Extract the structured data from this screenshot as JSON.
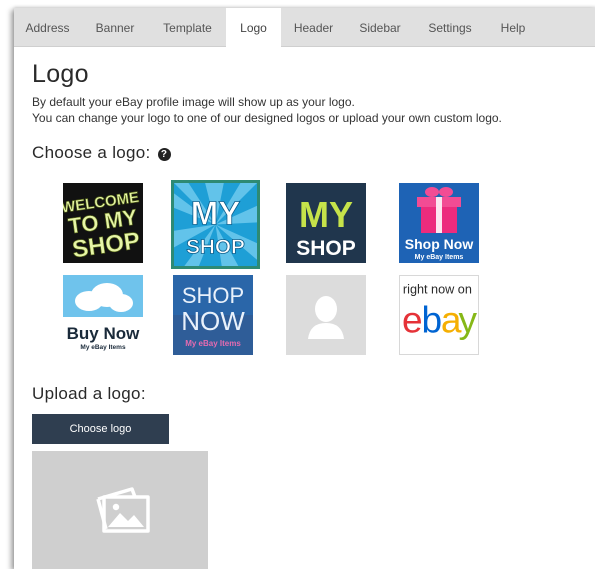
{
  "tabs": [
    {
      "label": "Address"
    },
    {
      "label": "Banner"
    },
    {
      "label": "Template"
    },
    {
      "label": "Logo",
      "active": true
    },
    {
      "label": "Header"
    },
    {
      "label": "Sidebar"
    },
    {
      "label": "Settings"
    },
    {
      "label": "Help"
    }
  ],
  "page": {
    "title": "Logo",
    "description_line1": "By default your eBay profile image will show up as your logo.",
    "description_line2": "You can change your logo to one of our designed logos or upload your own custom logo."
  },
  "choose_section": {
    "heading": "Choose a logo:",
    "help_icon": "question-circle-icon",
    "logos": [
      {
        "name": "welcome-to-my-shop",
        "lines": [
          "WELCOME",
          "TO MY",
          "SHOP"
        ],
        "selected": false
      },
      {
        "name": "my-shop-blue",
        "lines": [
          "MY",
          "SHOP"
        ],
        "selected": true
      },
      {
        "name": "my-shop-green",
        "lines": [
          "MY",
          "SHOP"
        ],
        "selected": false
      },
      {
        "name": "shop-now-gift",
        "lines": [
          "Shop Now",
          "My eBay Items"
        ],
        "selected": false
      },
      {
        "name": "buy-now-cloud",
        "lines": [
          "Buy Now",
          "My eBay Items"
        ],
        "selected": false
      },
      {
        "name": "shop-now-blue",
        "lines": [
          "SHOP",
          "NOW",
          "My eBay Items"
        ],
        "selected": false
      },
      {
        "name": "profile-silhouette",
        "lines": [],
        "selected": false
      },
      {
        "name": "right-now-on-ebay",
        "lines": [
          "right now on",
          "e",
          "b",
          "a",
          "y"
        ],
        "selected": false
      }
    ]
  },
  "upload_section": {
    "heading": "Upload a logo:",
    "button_label": "Choose logo",
    "placeholder_icon": "image-icon"
  },
  "colors": {
    "accent_dark": "#2f3e50",
    "selected_border": "#2e8a74",
    "tab_bar": "#e0e0e0",
    "ebay_red": "#e53238",
    "ebay_blue": "#0064d2",
    "ebay_yellow": "#f5af02",
    "ebay_green": "#86b817"
  }
}
